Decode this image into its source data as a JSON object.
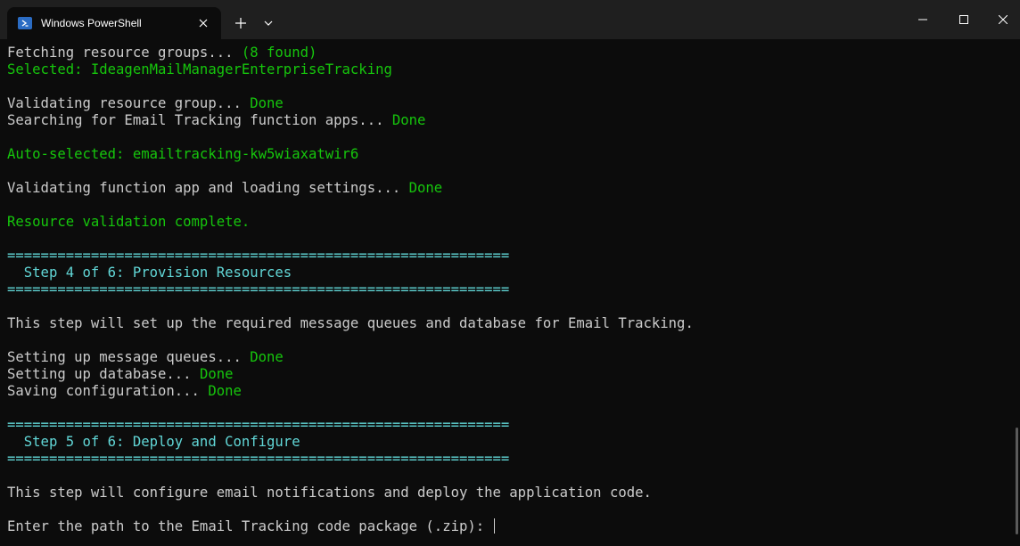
{
  "window": {
    "tab_title": "Windows PowerShell",
    "icons": {
      "tab": "powershell-icon",
      "close_tab": "close-icon",
      "new_tab": "plus-icon",
      "dropdown": "chevron-down-icon",
      "minimize": "minimize-icon",
      "maximize": "maximize-icon",
      "close_window": "close-icon"
    }
  },
  "colors": {
    "background": "#0c0c0c",
    "default_text": "#cccccc",
    "success": "#16c60c",
    "heading": "#61d6d6"
  },
  "terminal": {
    "lines": [
      {
        "segments": [
          {
            "text": "Fetching resource groups... ",
            "color": "default"
          },
          {
            "text": "(8 found)",
            "color": "green"
          }
        ]
      },
      {
        "segments": [
          {
            "text": "Selected: IdeagenMailManagerEnterpriseTracking",
            "color": "green"
          }
        ]
      },
      {
        "segments": []
      },
      {
        "segments": [
          {
            "text": "Validating resource group... ",
            "color": "default"
          },
          {
            "text": "Done",
            "color": "green"
          }
        ]
      },
      {
        "segments": [
          {
            "text": "Searching for Email Tracking function apps... ",
            "color": "default"
          },
          {
            "text": "Done",
            "color": "green"
          }
        ]
      },
      {
        "segments": []
      },
      {
        "segments": [
          {
            "text": "Auto-selected: emailtracking-kw5wiaxatwir6",
            "color": "green"
          }
        ]
      },
      {
        "segments": []
      },
      {
        "segments": [
          {
            "text": "Validating function app and loading settings... ",
            "color": "default"
          },
          {
            "text": "Done",
            "color": "green"
          }
        ]
      },
      {
        "segments": []
      },
      {
        "segments": [
          {
            "text": "Resource validation complete.",
            "color": "green"
          }
        ]
      },
      {
        "segments": []
      },
      {
        "segments": [
          {
            "text": "============================================================",
            "color": "cyan"
          }
        ]
      },
      {
        "segments": [
          {
            "text": "  Step 4 of 6: Provision Resources",
            "color": "cyan"
          }
        ]
      },
      {
        "segments": [
          {
            "text": "============================================================",
            "color": "cyan"
          }
        ]
      },
      {
        "segments": []
      },
      {
        "segments": [
          {
            "text": "This step will set up the required message queues and database for Email Tracking.",
            "color": "default"
          }
        ]
      },
      {
        "segments": []
      },
      {
        "segments": [
          {
            "text": "Setting up message queues... ",
            "color": "default"
          },
          {
            "text": "Done",
            "color": "green"
          }
        ]
      },
      {
        "segments": [
          {
            "text": "Setting up database... ",
            "color": "default"
          },
          {
            "text": "Done",
            "color": "green"
          }
        ]
      },
      {
        "segments": [
          {
            "text": "Saving configuration... ",
            "color": "default"
          },
          {
            "text": "Done",
            "color": "green"
          }
        ]
      },
      {
        "segments": []
      },
      {
        "segments": [
          {
            "text": "============================================================",
            "color": "cyan"
          }
        ]
      },
      {
        "segments": [
          {
            "text": "  Step 5 of 6: Deploy and Configure",
            "color": "cyan"
          }
        ]
      },
      {
        "segments": [
          {
            "text": "============================================================",
            "color": "cyan"
          }
        ]
      },
      {
        "segments": []
      },
      {
        "segments": [
          {
            "text": "This step will configure email notifications and deploy the application code.",
            "color": "default"
          }
        ]
      },
      {
        "segments": []
      },
      {
        "segments": [
          {
            "text": "Enter the path to the Email Tracking code package (.zip): ",
            "color": "default"
          }
        ],
        "cursor": true
      }
    ]
  }
}
